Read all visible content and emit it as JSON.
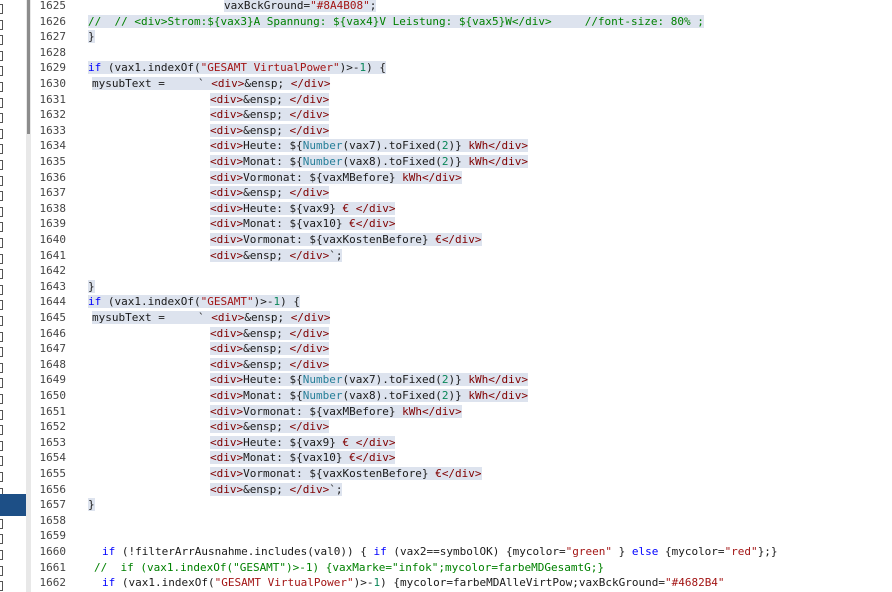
{
  "editor": {
    "lines": [
      {
        "n": "1625",
        "indent": 136,
        "text": "vaxBckGround=\"#8A4B08\";"
      },
      {
        "n": "1626",
        "indent": 0,
        "text": "//  // <div>Strom:${vax3}A Spannung: ${vax4}V Leistung: ${vax5}W</div>     //font-size: 80% ;"
      },
      {
        "n": "1627",
        "indent": 0,
        "text": "}"
      },
      {
        "n": "1628",
        "indent": 0,
        "text": ""
      },
      {
        "n": "1629",
        "indent": 0,
        "text": "if (vax1.indexOf(\"GESAMT VirtualPower\")>-1) {"
      },
      {
        "n": "1630",
        "indent": 4,
        "text": "mysubText =     ` <div>&ensp; </div>"
      },
      {
        "n": "1631",
        "indent": 122,
        "text": "<div>&ensp; </div>"
      },
      {
        "n": "1632",
        "indent": 122,
        "text": "<div>&ensp; </div>"
      },
      {
        "n": "1633",
        "indent": 122,
        "text": "<div>&ensp; </div>"
      },
      {
        "n": "1634",
        "indent": 122,
        "text": "<div>Heute: ${Number(vax7).toFixed(2)} kWh</div>"
      },
      {
        "n": "1635",
        "indent": 122,
        "text": "<div>Monat: ${Number(vax8).toFixed(2)} kWh</div>"
      },
      {
        "n": "1636",
        "indent": 122,
        "text": "<div>Vormonat: ${vaxMBefore} kWh</div>"
      },
      {
        "n": "1637",
        "indent": 122,
        "text": "<div>&ensp; </div>"
      },
      {
        "n": "1638",
        "indent": 122,
        "text": "<div>Heute: ${vax9} € </div>"
      },
      {
        "n": "1639",
        "indent": 122,
        "text": "<div>Monat: ${vax10} €</div>"
      },
      {
        "n": "1640",
        "indent": 122,
        "text": "<div>Vormonat: ${vaxKostenBefore} €</div>"
      },
      {
        "n": "1641",
        "indent": 122,
        "text": "<div>&ensp; </div>`;"
      },
      {
        "n": "1642",
        "indent": 0,
        "text": ""
      },
      {
        "n": "1643",
        "indent": 0,
        "text": "}"
      },
      {
        "n": "1644",
        "indent": 0,
        "text": "if (vax1.indexOf(\"GESAMT\")>-1) {"
      },
      {
        "n": "1645",
        "indent": 4,
        "text": "mysubText =     ` <div>&ensp; </div>"
      },
      {
        "n": "1646",
        "indent": 122,
        "text": "<div>&ensp; </div>"
      },
      {
        "n": "1647",
        "indent": 122,
        "text": "<div>&ensp; </div>"
      },
      {
        "n": "1648",
        "indent": 122,
        "text": "<div>&ensp; </div>"
      },
      {
        "n": "1649",
        "indent": 122,
        "text": "<div>Heute: ${Number(vax7).toFixed(2)} kWh</div>"
      },
      {
        "n": "1650",
        "indent": 122,
        "text": "<div>Monat: ${Number(vax8).toFixed(2)} kWh</div>"
      },
      {
        "n": "1651",
        "indent": 122,
        "text": "<div>Vormonat: ${vaxMBefore} kWh</div>"
      },
      {
        "n": "1652",
        "indent": 122,
        "text": "<div>&ensp; </div>"
      },
      {
        "n": "1653",
        "indent": 122,
        "text": "<div>Heute: ${vax9} € </div>"
      },
      {
        "n": "1654",
        "indent": 122,
        "text": "<div>Monat: ${vax10} €</div>"
      },
      {
        "n": "1655",
        "indent": 122,
        "text": "<div>Vormonat: ${vaxKostenBefore} €</div>"
      },
      {
        "n": "1656",
        "indent": 122,
        "text": "<div>&ensp; </div>`;"
      },
      {
        "n": "1657",
        "indent": 0,
        "text": "}"
      },
      {
        "n": "1658",
        "indent": 0,
        "text": ""
      },
      {
        "n": "1659",
        "indent": 0,
        "text": ""
      },
      {
        "n": "1660",
        "indent": 14,
        "text": "if (!filterArrAusnahme.includes(val0)) { if (vax2==symbolOK) {mycolor=\"green\" } else {mycolor=\"red\"};}"
      },
      {
        "n": "1661",
        "indent": 6,
        "text": "//  if (vax1.indexOf(\"GESAMT\")>-1) {vaxMarke=\"infok\";mycolor=farbeMDGesamtG;}"
      },
      {
        "n": "1662",
        "indent": 14,
        "text": "if (vax1.indexOf(\"GESAMT VirtualPower\")>-1) {mycolor=farbeMDAlleVirtPow;vaxBckGround=\"#4682B4\""
      }
    ],
    "selected_range": [
      "1625",
      "1657"
    ],
    "colors": {
      "keyword": "#0000ff",
      "string": "#a31515",
      "comment": "#008000",
      "tag": "#800000",
      "function": "#267f99",
      "number": "#098658",
      "selection": "#dde3ee",
      "gutter_active": "#1d4f86"
    }
  }
}
